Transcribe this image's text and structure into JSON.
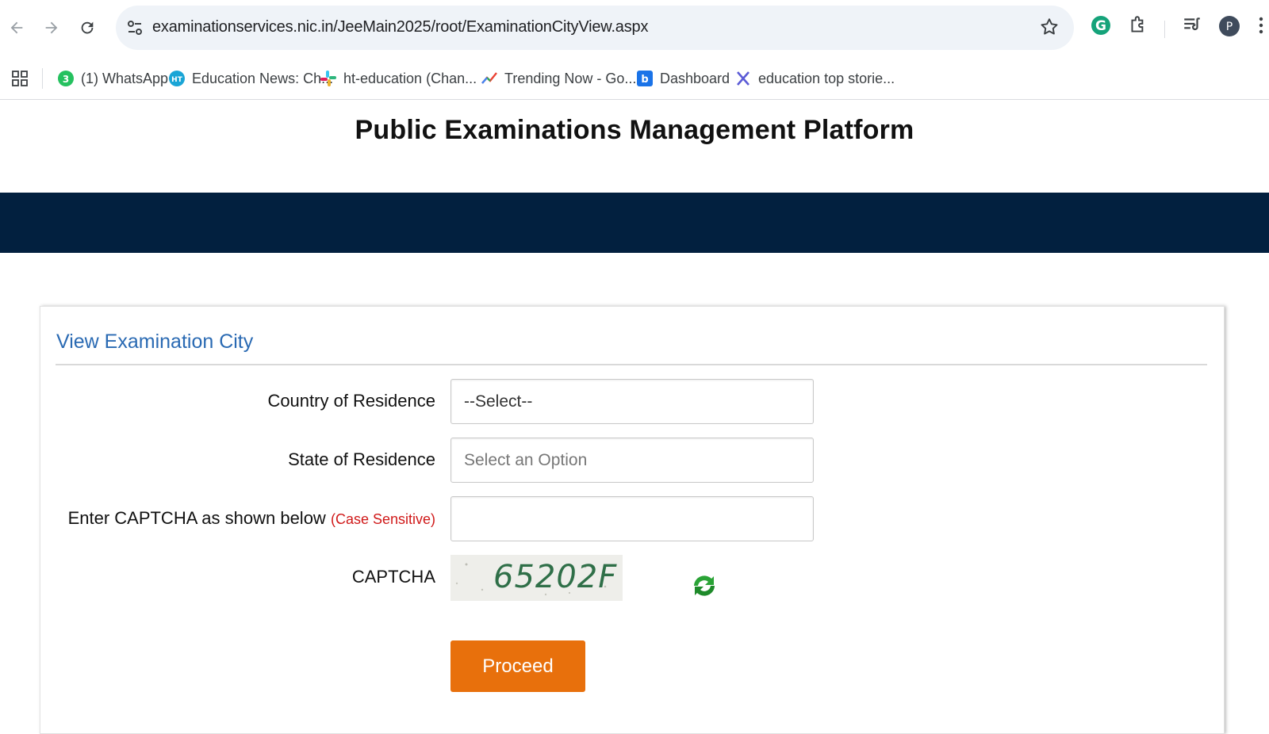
{
  "browser": {
    "url": "examinationservices.nic.in/JeeMain2025/root/ExaminationCityView.aspx",
    "profile_initial": "P",
    "bookmarks": [
      {
        "label": "(1) WhatsApp",
        "icon": "whatsapp-icon"
      },
      {
        "label": "Education News: Ch...",
        "icon": "ht-icon"
      },
      {
        "label": "ht-education (Chan...",
        "icon": "slack-icon"
      },
      {
        "label": "Trending Now - Go...",
        "icon": "trends-icon"
      },
      {
        "label": "Dashboard",
        "icon": "dashboard-icon"
      },
      {
        "label": "education top storie...",
        "icon": "x-icon"
      }
    ]
  },
  "page": {
    "site_title": "Public Examinations Management Platform",
    "banner_color": "#02203f",
    "form_title": "View Examination City",
    "fields": {
      "country_label": "Country of Residence",
      "country_value": "--Select--",
      "state_label": "State of Residence",
      "state_placeholder": "Select an Option",
      "captcha_input_label": "Enter CAPTCHA as shown below",
      "captcha_note": "(Case Sensitive)",
      "captcha_input_value": "",
      "captcha_label": "CAPTCHA",
      "captcha_code": "65202F"
    },
    "proceed_label": "Proceed",
    "accent_color": "#e8700c"
  }
}
